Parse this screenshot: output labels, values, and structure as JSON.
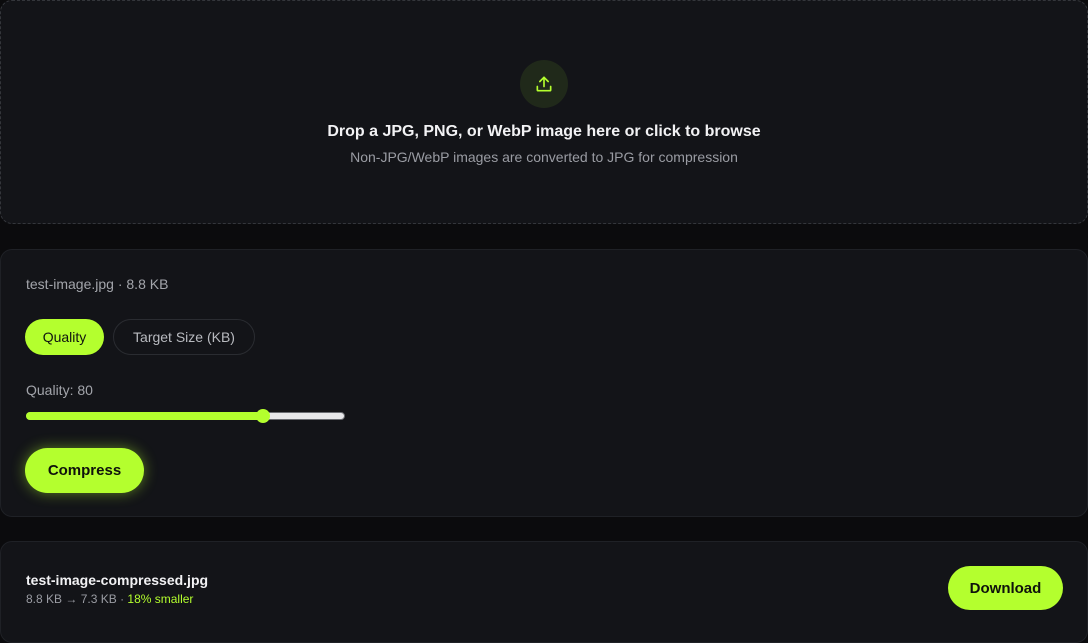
{
  "dropzone": {
    "icon": "upload-icon",
    "title": "Drop a JPG, PNG, or WebP image here or click to browse",
    "subtitle": "Non-JPG/WebP images are converted to JPG for compression"
  },
  "settings": {
    "file_name": "test-image.jpg",
    "separator": " · ",
    "file_size": "8.8 KB",
    "tabs": [
      {
        "label": "Quality",
        "active": true
      },
      {
        "label": "Target Size (KB)",
        "active": false
      }
    ],
    "quality_label_prefix": "Quality: ",
    "quality_value": "80",
    "slider": {
      "min": 0,
      "max": 100,
      "value": 80
    },
    "compress_label": "Compress"
  },
  "result": {
    "file_name": "test-image-compressed.jpg",
    "original_size": "8.8 KB",
    "arrow": " → ",
    "new_size": "7.3 KB",
    "separator": " · ",
    "savings": "18% smaller",
    "download_label": "Download"
  },
  "colors": {
    "accent": "#b4ff2e",
    "background": "#0b0b0d",
    "panel": "#131418"
  }
}
